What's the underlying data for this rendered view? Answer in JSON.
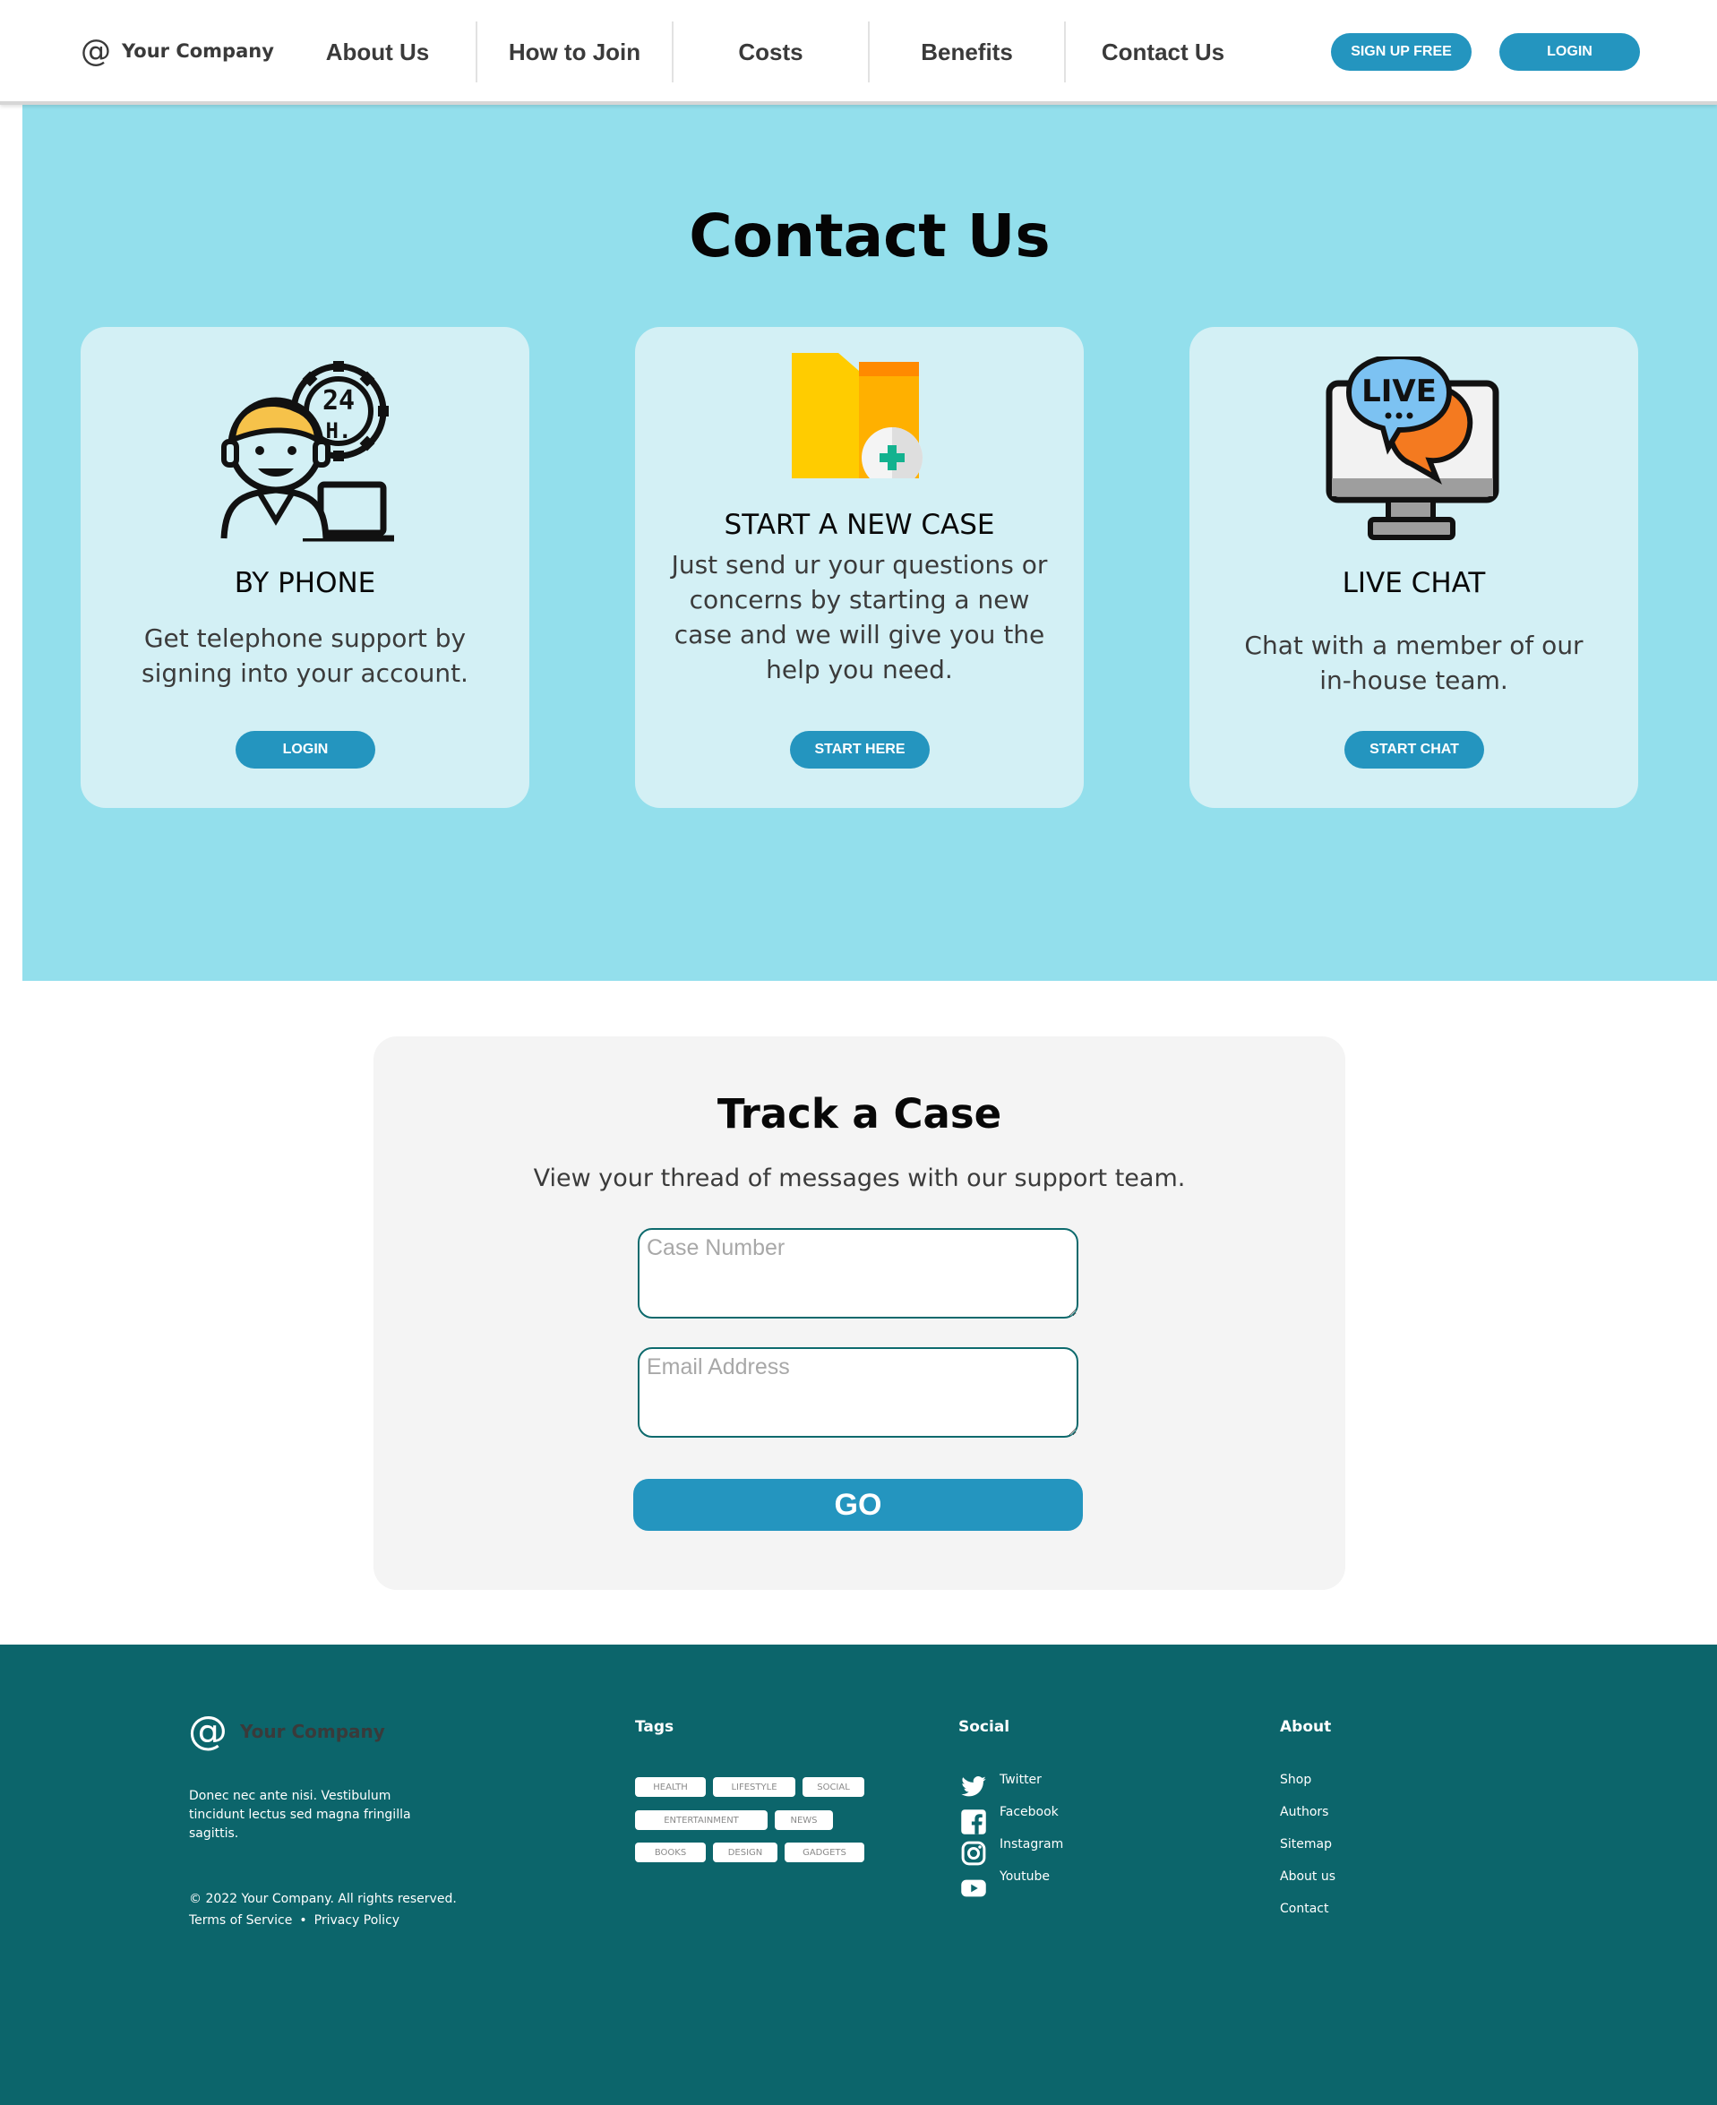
{
  "nav": {
    "brand_symbol": "@",
    "brand_name": "Your Company",
    "links": [
      "About Us",
      "How to Join",
      "Costs",
      "Benefits",
      "Contact Us"
    ],
    "signup_label": "SIGN UP FREE",
    "login_label": "LOGIN"
  },
  "hero": {
    "title": "Contact Us",
    "cards": [
      {
        "icon": "support-24h-agent-icon",
        "title": "BY PHONE",
        "text": "Get telephone support by signing into your account.",
        "button": "LOGIN"
      },
      {
        "icon": "folder-add-icon",
        "title": "START A NEW CASE",
        "text": "Just send ur your questions or concerns by starting a new case and we will give you the help you need.",
        "button": "START HERE"
      },
      {
        "icon": "live-chat-monitor-icon",
        "icon_text": "LIVE",
        "title": "LIVE CHAT",
        "text": "Chat with a member of our in-house team.",
        "button": "START CHAT"
      }
    ]
  },
  "track": {
    "title": "Track a Case",
    "subtitle": "View your thread of messages with our support team.",
    "case_placeholder": "Case Number",
    "email_placeholder": "Email Address",
    "go_label": "GO"
  },
  "footer": {
    "brand_symbol": "@",
    "brand_name": "Your Company",
    "description": "Donec nec ante nisi. Vestibulum tincidunt lectus sed magna fringilla sagittis.",
    "copyright": "© 2022 Your Company.  All rights reserved.",
    "terms": "Terms of Service",
    "separator": "•",
    "privacy": "Privacy Policy",
    "tags_heading": "Tags",
    "tags": [
      "HEALTH",
      "LIFESTYLE",
      "SOCIAL",
      "ENTERTAINMENT",
      "NEWS",
      "BOOKS",
      "DESIGN",
      "GADGETS"
    ],
    "social_heading": "Social",
    "social": [
      {
        "label": "Twitter",
        "icon": "twitter-icon"
      },
      {
        "label": "Facebook",
        "icon": "facebook-icon"
      },
      {
        "label": "Instagram",
        "icon": "instagram-icon"
      },
      {
        "label": "Youtube",
        "icon": "youtube-icon"
      }
    ],
    "about_heading": "About",
    "about_links": [
      "Shop",
      "Authors",
      "Sitemap",
      "About us",
      "Contact"
    ]
  },
  "colors": {
    "accent": "#2495bf",
    "hero_bg": "#93dfec",
    "card_bg": "#d3f0f5",
    "footer_bg": "#0c656b",
    "track_bg": "#f4f4f4"
  }
}
